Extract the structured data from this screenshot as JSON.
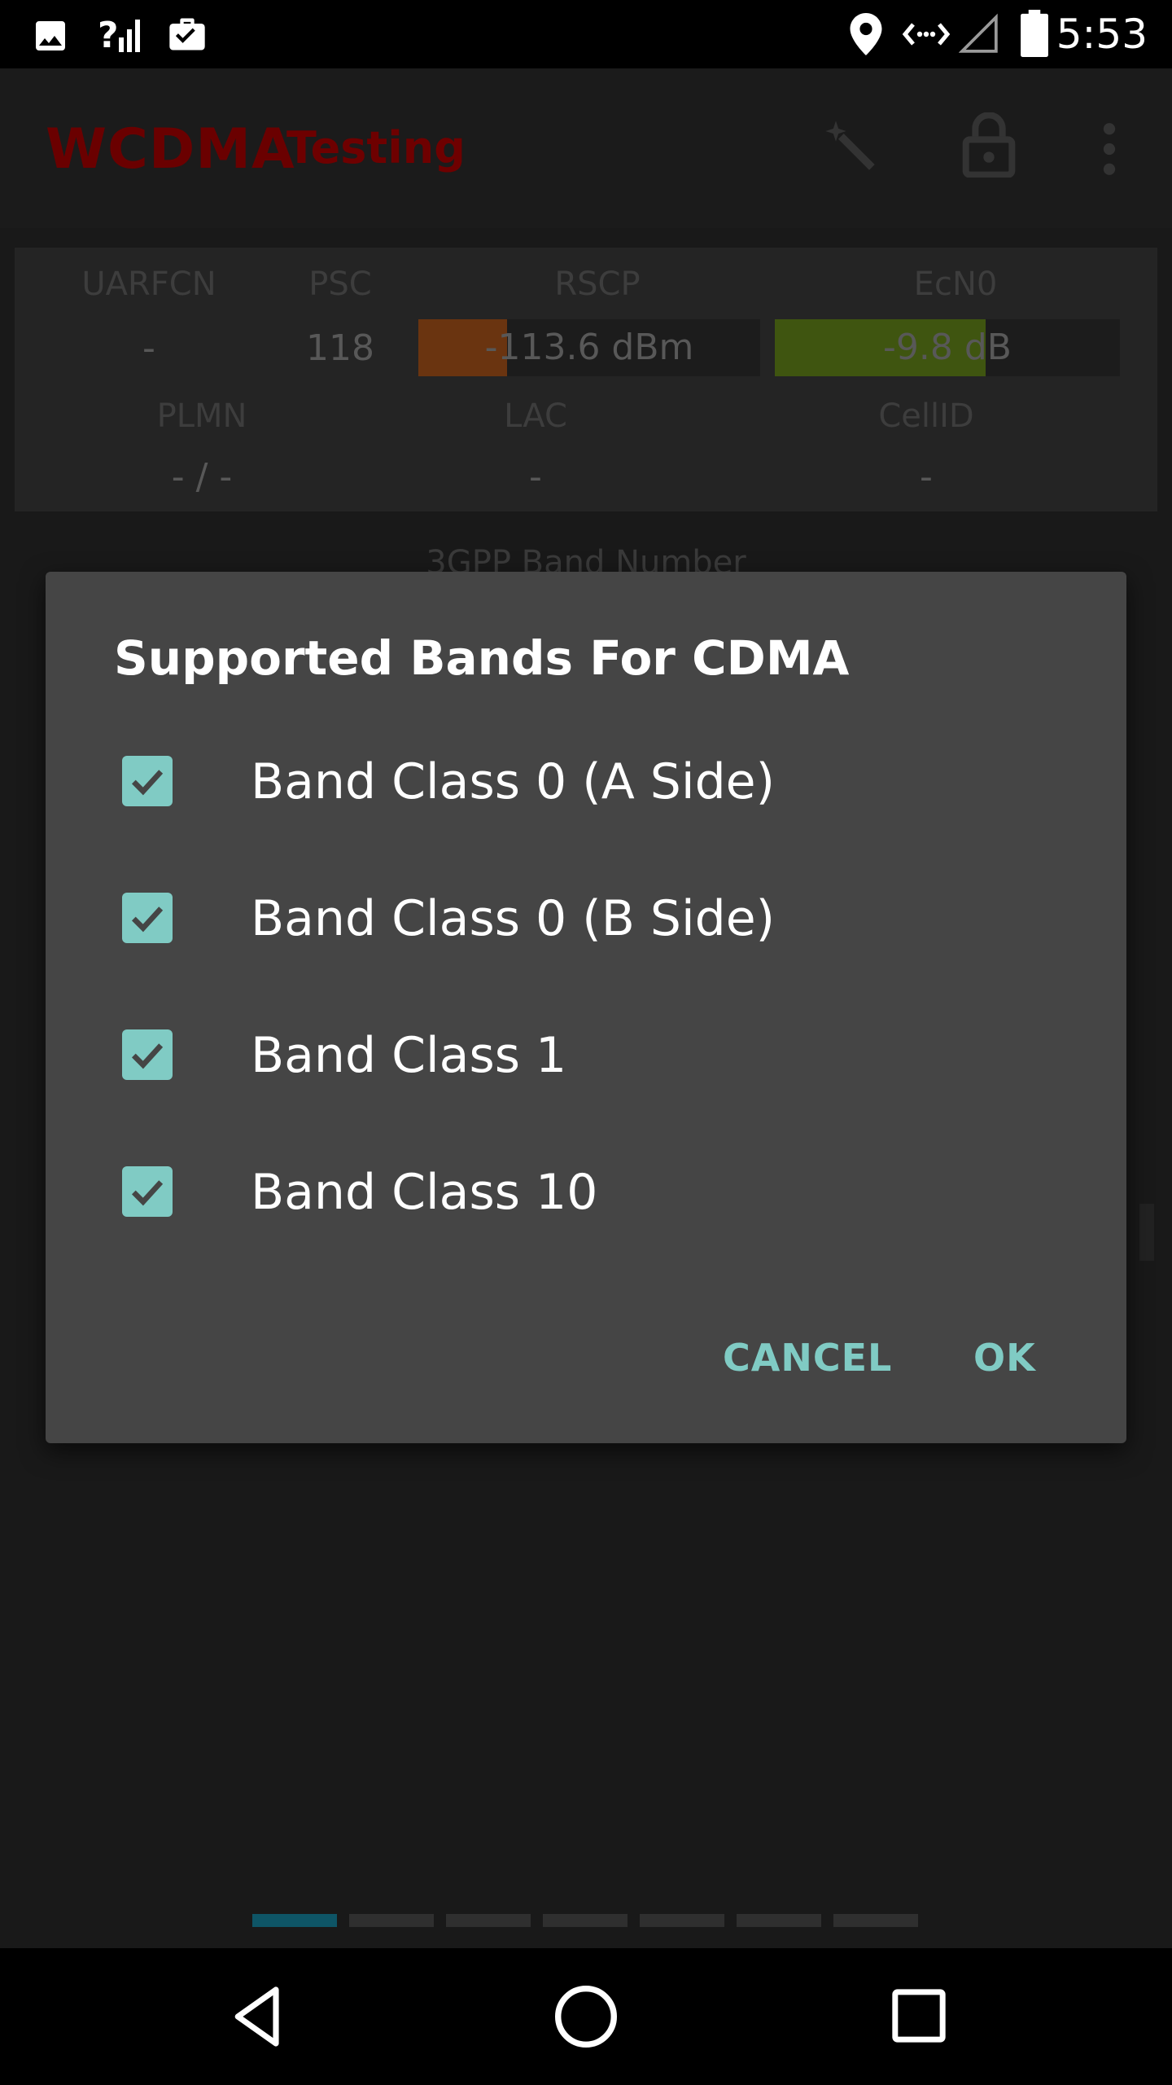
{
  "status_bar": {
    "time": "5:53",
    "icons": [
      "image-icon",
      "signal-unknown-icon",
      "briefcase-check-icon",
      "location-icon",
      "data-arrows-icon",
      "cell-signal-empty-icon",
      "battery-icon"
    ]
  },
  "app_bar": {
    "title": "WCDMA",
    "subtitle": "Testing",
    "actions": [
      "magic-wand-icon",
      "lock-open-icon",
      "more-vert-icon"
    ]
  },
  "info": {
    "uarfcn_label": "UARFCN",
    "uarfcn_value": "-",
    "psc_label": "PSC",
    "psc_value": "118",
    "rscp_label": "RSCP",
    "rscp_value": "-113.6 dBm",
    "rscp_level": 0.26,
    "ecn0_label": "EcN0",
    "ecn0_value": "-9.8 dB",
    "ecn0_level": 0.61,
    "plmn_label": "PLMN",
    "plmn_value": "- / -",
    "lac_label": "LAC",
    "lac_value": "-",
    "cellid_label": "CellID",
    "cellid_value": "-",
    "rscp_color": "#6a3410",
    "ecn0_color": "#3f5510"
  },
  "behind_text": "3GPP Band Number",
  "dialog": {
    "title": "Supported Bands For CDMA",
    "options": [
      {
        "label": "Band Class 0 (A Side)",
        "checked": true
      },
      {
        "label": "Band Class 0 (B Side)",
        "checked": true
      },
      {
        "label": "Band Class 1",
        "checked": true
      },
      {
        "label": "Band Class 10",
        "checked": true
      }
    ],
    "cancel_label": "CANCEL",
    "ok_label": "OK",
    "accent": "#80cbc4"
  },
  "pager": {
    "count": 7,
    "active_index": 0
  },
  "nav": {
    "buttons": [
      "back-icon",
      "home-icon",
      "recents-icon"
    ]
  }
}
